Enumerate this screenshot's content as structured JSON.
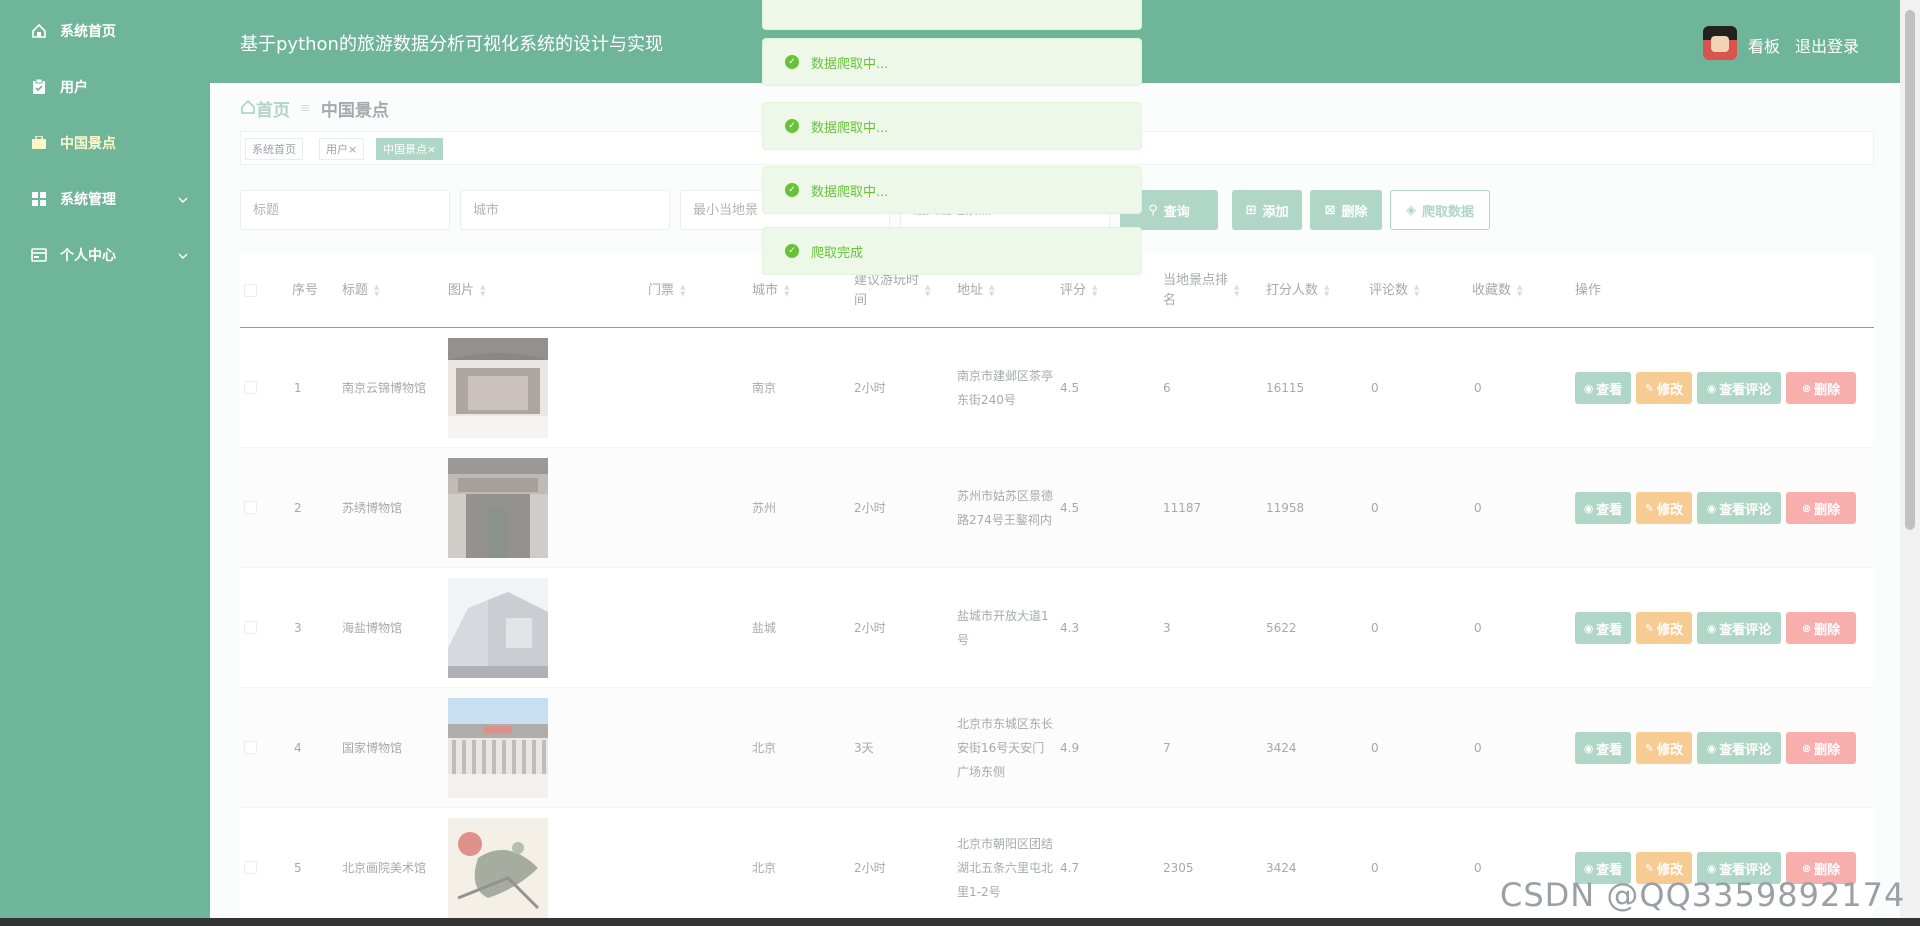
{
  "sidebar": {
    "items": [
      {
        "label": "系统首页",
        "icon": "home-icon"
      },
      {
        "label": "用户",
        "icon": "clipboard-icon"
      },
      {
        "label": "中国景点",
        "icon": "briefcase-icon"
      },
      {
        "label": "系统管理",
        "icon": "grid-icon"
      },
      {
        "label": "个人中心",
        "icon": "card-icon"
      }
    ]
  },
  "header": {
    "title": "基于python的旅游数据分析可视化系统的设计与实现",
    "dashboard_link": "看板",
    "logout_link": "退出登录"
  },
  "breadcrumb": {
    "home": "首页",
    "current": "中国景点"
  },
  "tags": [
    {
      "label": "系统首页"
    },
    {
      "label": "用户×"
    },
    {
      "label": "中国景点×"
    }
  ],
  "search": {
    "title_placeholder": "标题",
    "city_placeholder": "城市",
    "min_rank_placeholder": "最小当地景",
    "max_rank_placeholder": "最大当地景点"
  },
  "buttons": {
    "query": "查询",
    "add": "添加",
    "delete": "删除",
    "crawl": "爬取数据"
  },
  "toasts": [
    {
      "text": "数据爬取中..."
    },
    {
      "text": "数据爬取中..."
    },
    {
      "text": "数据爬取中..."
    },
    {
      "text": "爬取完成"
    }
  ],
  "table": {
    "headers": {
      "index": "序号",
      "title": "标题",
      "image": "图片",
      "ticket": "门票",
      "city": "城市",
      "duration_l1": "建议游玩时",
      "duration_l2": "间",
      "address": "地址",
      "rating": "评分",
      "rank_l1": "当地景点排",
      "rank_l2": "名",
      "raters": "打分人数",
      "comments": "评论数",
      "favorites": "收藏数",
      "actions": "操作"
    },
    "rows": [
      {
        "index": "1",
        "title": "南京云锦博物馆",
        "ticket": "",
        "city": "南京",
        "duration": "2小时",
        "address": "南京市建邺区茶亭东街240号",
        "rating": "4.5",
        "rank": "6",
        "raters": "16115",
        "comments": "0",
        "favorites": "0"
      },
      {
        "index": "2",
        "title": "苏绣博物馆",
        "ticket": "",
        "city": "苏州",
        "duration": "2小时",
        "address": "苏州市姑苏区景德路274号王鏊祠内",
        "rating": "4.5",
        "rank": "11187",
        "raters": "11958",
        "comments": "0",
        "favorites": "0"
      },
      {
        "index": "3",
        "title": "海盐博物馆",
        "ticket": "",
        "city": "盐城",
        "duration": "2小时",
        "address": "盐城市开放大道1号",
        "rating": "4.3",
        "rank": "3",
        "raters": "5622",
        "comments": "0",
        "favorites": "0"
      },
      {
        "index": "4",
        "title": "国家博物馆",
        "ticket": "",
        "city": "北京",
        "duration": "3天",
        "address": "北京市东城区东长安街16号天安门广场东侧",
        "rating": "4.9",
        "rank": "7",
        "raters": "3424",
        "comments": "0",
        "favorites": "0"
      },
      {
        "index": "5",
        "title": "北京画院美术馆",
        "ticket": "",
        "city": "北京",
        "duration": "2小时",
        "address": "北京市朝阳区团结湖北五条六里屯北里1-2号",
        "rating": "4.7",
        "rank": "2305",
        "raters": "3424",
        "comments": "0",
        "favorites": "0"
      }
    ],
    "row_actions": {
      "view": "查看",
      "edit": "修改",
      "view_comments": "查看评论",
      "delete": "删除"
    }
  },
  "watermark": "CSDN @QQ3359892174",
  "colors": {
    "theme": "#6fb59a",
    "edit": "#f0a33a",
    "danger": "#f56c6c",
    "success": "#67c23a"
  }
}
